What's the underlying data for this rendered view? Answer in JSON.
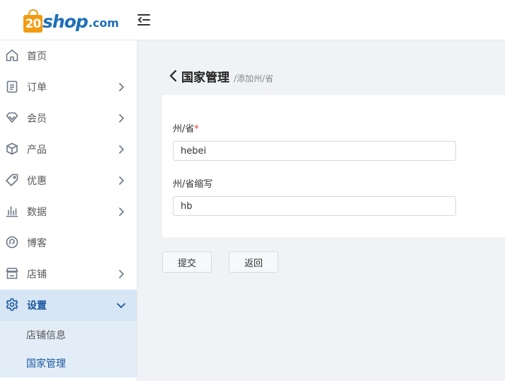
{
  "logo": {
    "badge": "20",
    "shop": "shop",
    "com": ".com"
  },
  "sidebar": {
    "items": [
      {
        "label": "首页"
      },
      {
        "label": "订单"
      },
      {
        "label": "会员"
      },
      {
        "label": "产品"
      },
      {
        "label": "优惠"
      },
      {
        "label": "数据"
      },
      {
        "label": "博客"
      },
      {
        "label": "店铺"
      },
      {
        "label": "设置"
      }
    ],
    "settings_sub": [
      {
        "label": "店铺信息"
      },
      {
        "label": "国家管理"
      }
    ]
  },
  "page": {
    "title": "国家管理",
    "subtitle": "/添加州/省"
  },
  "form": {
    "state": {
      "label": "州/省",
      "required_mark": "*",
      "value": "hebei"
    },
    "abbr": {
      "label": "州/省缩写",
      "value": "hb"
    }
  },
  "buttons": {
    "submit": "提交",
    "back": "返回"
  },
  "colors": {
    "accent": "#1a56a0",
    "active_bg": "#d6e6f5",
    "sub_bg": "#e3edf8",
    "logo_orange": "#f39c12",
    "logo_blue": "#1e6fb8"
  }
}
